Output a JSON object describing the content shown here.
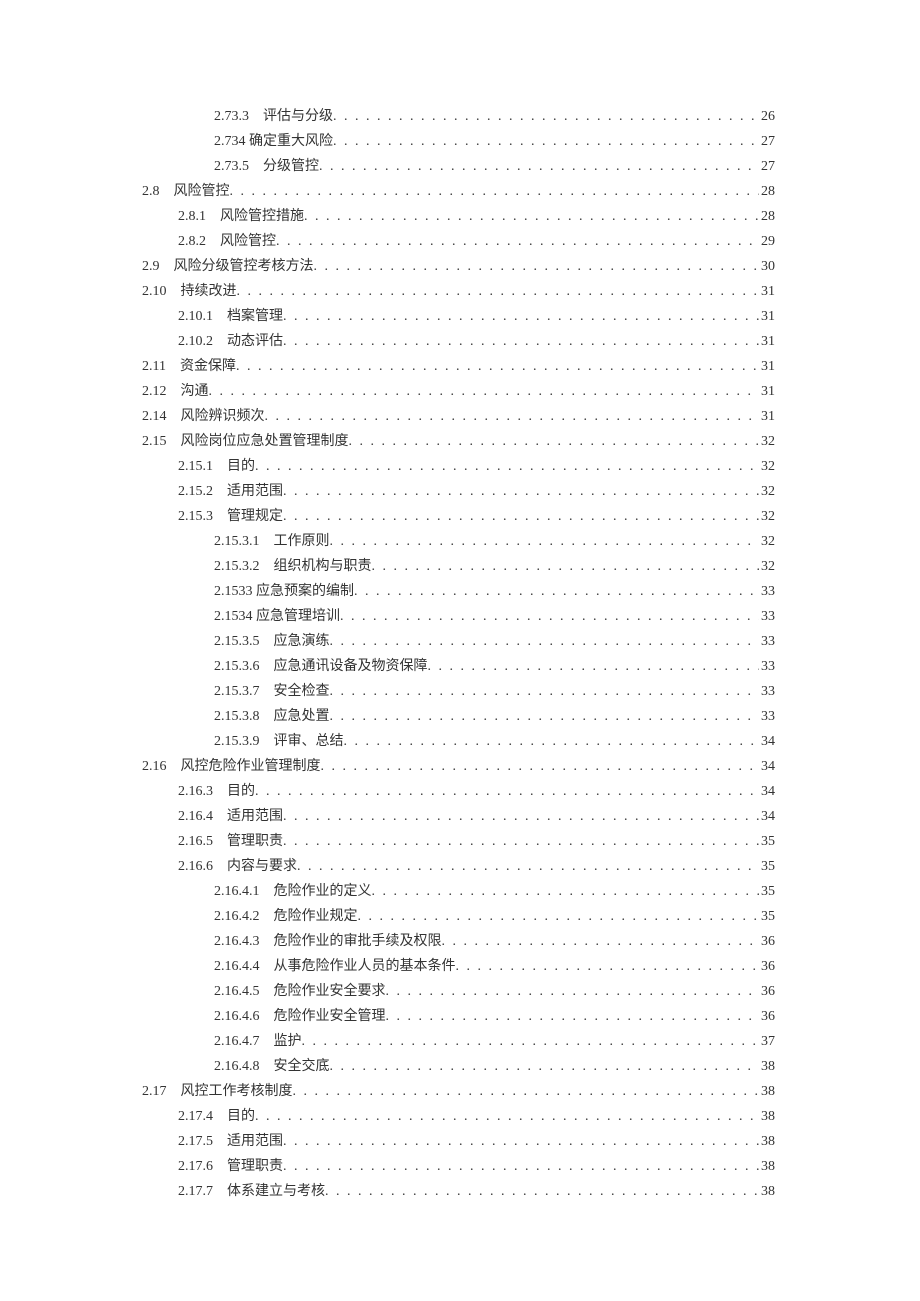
{
  "toc": [
    {
      "level": 3,
      "num": "2.73.3",
      "title": "评估与分级",
      "page": "26"
    },
    {
      "level": 3,
      "num": "2.734",
      "title": "确定重大风险",
      "page": "27",
      "tight": true
    },
    {
      "level": 3,
      "num": "2.73.5",
      "title": "分级管控",
      "page": "27"
    },
    {
      "level": 1,
      "num": "2.8",
      "title": "风险管控",
      "page": "28"
    },
    {
      "level": 2,
      "num": "2.8.1",
      "title": "风险管控措施",
      "page": "28"
    },
    {
      "level": 2,
      "num": "2.8.2",
      "title": "风险管控",
      "page": "29"
    },
    {
      "level": 1,
      "num": "2.9",
      "title": "风险分级管控考核方法",
      "page": "30"
    },
    {
      "level": 1,
      "num": "2.10",
      "title": "持续改进",
      "page": "31"
    },
    {
      "level": 2,
      "num": "2.10.1",
      "title": "档案管理",
      "page": "31"
    },
    {
      "level": 2,
      "num": "2.10.2",
      "title": "动态评估",
      "page": "31"
    },
    {
      "level": 1,
      "num": "2.11",
      "title": "资金保障",
      "page": "31"
    },
    {
      "level": 1,
      "num": "2.12",
      "title": "沟通",
      "page": "31"
    },
    {
      "level": 1,
      "num": "2.14",
      "title": "风险辨识频次",
      "page": "31"
    },
    {
      "level": 1,
      "num": "2.15",
      "title": "风险岗位应急处置管理制度",
      "page": "32"
    },
    {
      "level": 2,
      "num": "2.15.1",
      "title": "目的",
      "page": "32"
    },
    {
      "level": 2,
      "num": "2.15.2",
      "title": "适用范围",
      "page": "32"
    },
    {
      "level": 2,
      "num": "2.15.3",
      "title": "管理规定",
      "page": "32"
    },
    {
      "level": 3,
      "num": "2.15.3.1",
      "title": "工作原则",
      "page": "32"
    },
    {
      "level": 3,
      "num": "2.15.3.2",
      "title": "组织机构与职责",
      "page": "32"
    },
    {
      "level": 3,
      "num": "2.1533",
      "title": "应急预案的编制",
      "page": "33",
      "tight": true
    },
    {
      "level": 3,
      "num": "2.1534",
      "title": "应急管理培训",
      "page": "33",
      "tight": true
    },
    {
      "level": 3,
      "num": "2.15.3.5",
      "title": "应急演练",
      "page": "33"
    },
    {
      "level": 3,
      "num": "2.15.3.6",
      "title": "应急通讯设备及物资保障",
      "page": "33"
    },
    {
      "level": 3,
      "num": "2.15.3.7",
      "title": "安全检查",
      "page": "33"
    },
    {
      "level": 3,
      "num": "2.15.3.8",
      "title": "应急处置",
      "page": "33"
    },
    {
      "level": 3,
      "num": "2.15.3.9",
      "title": "评审、总结",
      "page": "34"
    },
    {
      "level": 1,
      "num": "2.16",
      "title": "风控危险作业管理制度",
      "page": "34"
    },
    {
      "level": 2,
      "num": "2.16.3",
      "title": "目的",
      "page": "34"
    },
    {
      "level": 2,
      "num": "2.16.4",
      "title": "适用范围",
      "page": "34"
    },
    {
      "level": 2,
      "num": "2.16.5",
      "title": "管理职责",
      "page": "35"
    },
    {
      "level": 2,
      "num": "2.16.6",
      "title": "内容与要求",
      "page": "35"
    },
    {
      "level": 3,
      "num": "2.16.4.1",
      "title": "危险作业的定义",
      "page": "35"
    },
    {
      "level": 3,
      "num": "2.16.4.2",
      "title": "危险作业规定",
      "page": "35"
    },
    {
      "level": 3,
      "num": "2.16.4.3",
      "title": "危险作业的审批手续及权限",
      "page": "36"
    },
    {
      "level": 3,
      "num": "2.16.4.4",
      "title": "从事危险作业人员的基本条件",
      "page": "36"
    },
    {
      "level": 3,
      "num": "2.16.4.5",
      "title": "危险作业安全要求",
      "page": "36"
    },
    {
      "level": 3,
      "num": "2.16.4.6",
      "title": "危险作业安全管理",
      "page": "36"
    },
    {
      "level": 3,
      "num": "2.16.4.7",
      "title": "监护",
      "page": "37"
    },
    {
      "level": 3,
      "num": "2.16.4.8",
      "title": "安全交底",
      "page": "38"
    },
    {
      "level": 1,
      "num": "2.17",
      "title": "风控工作考核制度",
      "page": "38"
    },
    {
      "level": 2,
      "num": "2.17.4",
      "title": "目的",
      "page": "38"
    },
    {
      "level": 2,
      "num": "2.17.5",
      "title": "适用范围",
      "page": "38"
    },
    {
      "level": 2,
      "num": "2.17.6",
      "title": "管理职责",
      "page": "38"
    },
    {
      "level": 2,
      "num": "2.17.7",
      "title": "体系建立与考核",
      "page": "38"
    }
  ]
}
